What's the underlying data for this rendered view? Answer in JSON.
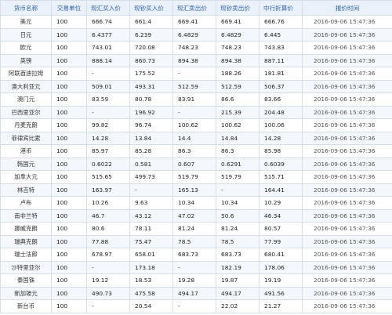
{
  "headers": [
    "货币名称",
    "交易单位",
    "现汇买入价",
    "现钞买入价",
    "现汇卖出价",
    "现钞卖出价",
    "中行折算价",
    "报价时间"
  ],
  "rows": [
    [
      "美元",
      "100",
      "666.74",
      "661.4",
      "669.41",
      "669.41",
      "666.76",
      "2016-09-06 15:47:36"
    ],
    [
      "日元",
      "100",
      "6.4377",
      "6.239",
      "6.4829",
      "6.4829",
      "6.445",
      "2016-09-06 15:47:36"
    ],
    [
      "欧元",
      "100",
      "743.01",
      "720.08",
      "748.23",
      "748.23",
      "743.83",
      "2016-09-06 15:47:36"
    ],
    [
      "英镑",
      "100",
      "888.14",
      "860.73",
      "894.38",
      "894.38",
      "887.11",
      "2016-09-06 15:47:36"
    ],
    [
      "阿联酋迪拉姆",
      "100",
      "-",
      "175.52",
      "-",
      "188.26",
      "181.81",
      "2016-09-06 15:47:36"
    ],
    [
      "澳大利亚元",
      "100",
      "509.01",
      "493.31",
      "512.59",
      "512.59",
      "506.37",
      "2016-09-06 15:47:36"
    ],
    [
      "澳门元",
      "100",
      "83.59",
      "80.78",
      "83.91",
      "86.6",
      "83.66",
      "2016-09-06 15:47:36"
    ],
    [
      "巴西里亚尔",
      "100",
      "-",
      "196.92",
      "-",
      "215.39",
      "204.48",
      "2016-09-06 15:47:36"
    ],
    [
      "丹麦克朗",
      "100",
      "99.82",
      "96.74",
      "100.62",
      "100.62",
      "100.06",
      "2016-09-06 15:47:36"
    ],
    [
      "菲律宾比索",
      "100",
      "14.28",
      "13.84",
      "14.4",
      "14.84",
      "14.28",
      "2016-09-06 15:47:36"
    ],
    [
      "港币",
      "100",
      "85.97",
      "85.28",
      "86.3",
      "86.3",
      "85.98",
      "2016-09-06 15:47:36"
    ],
    [
      "韩国元",
      "100",
      "0.6022",
      "0.581",
      "0.607",
      "0.6291",
      "0.6039",
      "2016-09-06 15:47:36"
    ],
    [
      "加拿大元",
      "100",
      "515.65",
      "499.73",
      "519.79",
      "519.79",
      "515.71",
      "2016-09-06 15:47:36"
    ],
    [
      "林吉特",
      "100",
      "163.97",
      "-",
      "165.13",
      "-",
      "164.41",
      "2016-09-06 15:47:36"
    ],
    [
      "卢布",
      "100",
      "10.26",
      "9.63",
      "10.34",
      "10.34",
      "10.29",
      "2016-09-06 15:47:36"
    ],
    [
      "南非兰特",
      "100",
      "46.7",
      "43.12",
      "47.02",
      "50.6",
      "46.34",
      "2016-09-06 15:47:36"
    ],
    [
      "挪威克朗",
      "100",
      "80.6",
      "78.11",
      "81.24",
      "81.24",
      "80.57",
      "2016-09-06 15:47:36"
    ],
    [
      "瑞典克朗",
      "100",
      "77.88",
      "75.47",
      "78.5",
      "78.5",
      "77.99",
      "2016-09-06 15:47:36"
    ],
    [
      "瑞士法郎",
      "100",
      "678.97",
      "658.01",
      "683.73",
      "683.73",
      "680.41",
      "2016-09-06 15:47:36"
    ],
    [
      "沙特里亚尔",
      "100",
      "-",
      "173.18",
      "-",
      "182.19",
      "178.06",
      "2016-09-06 15:47:36"
    ],
    [
      "泰国铢",
      "100",
      "19.12",
      "18.53",
      "19.28",
      "19.87",
      "19.19",
      "2016-09-06 15:47:36"
    ],
    [
      "新加坡元",
      "100",
      "490.73",
      "475.58",
      "494.17",
      "494.17",
      "491.56",
      "2016-09-06 15:47:36"
    ],
    [
      "新台币",
      "100",
      "-",
      "20.54",
      "-",
      "22.02",
      "21.27",
      "2016-09-06 15:47:36"
    ]
  ]
}
